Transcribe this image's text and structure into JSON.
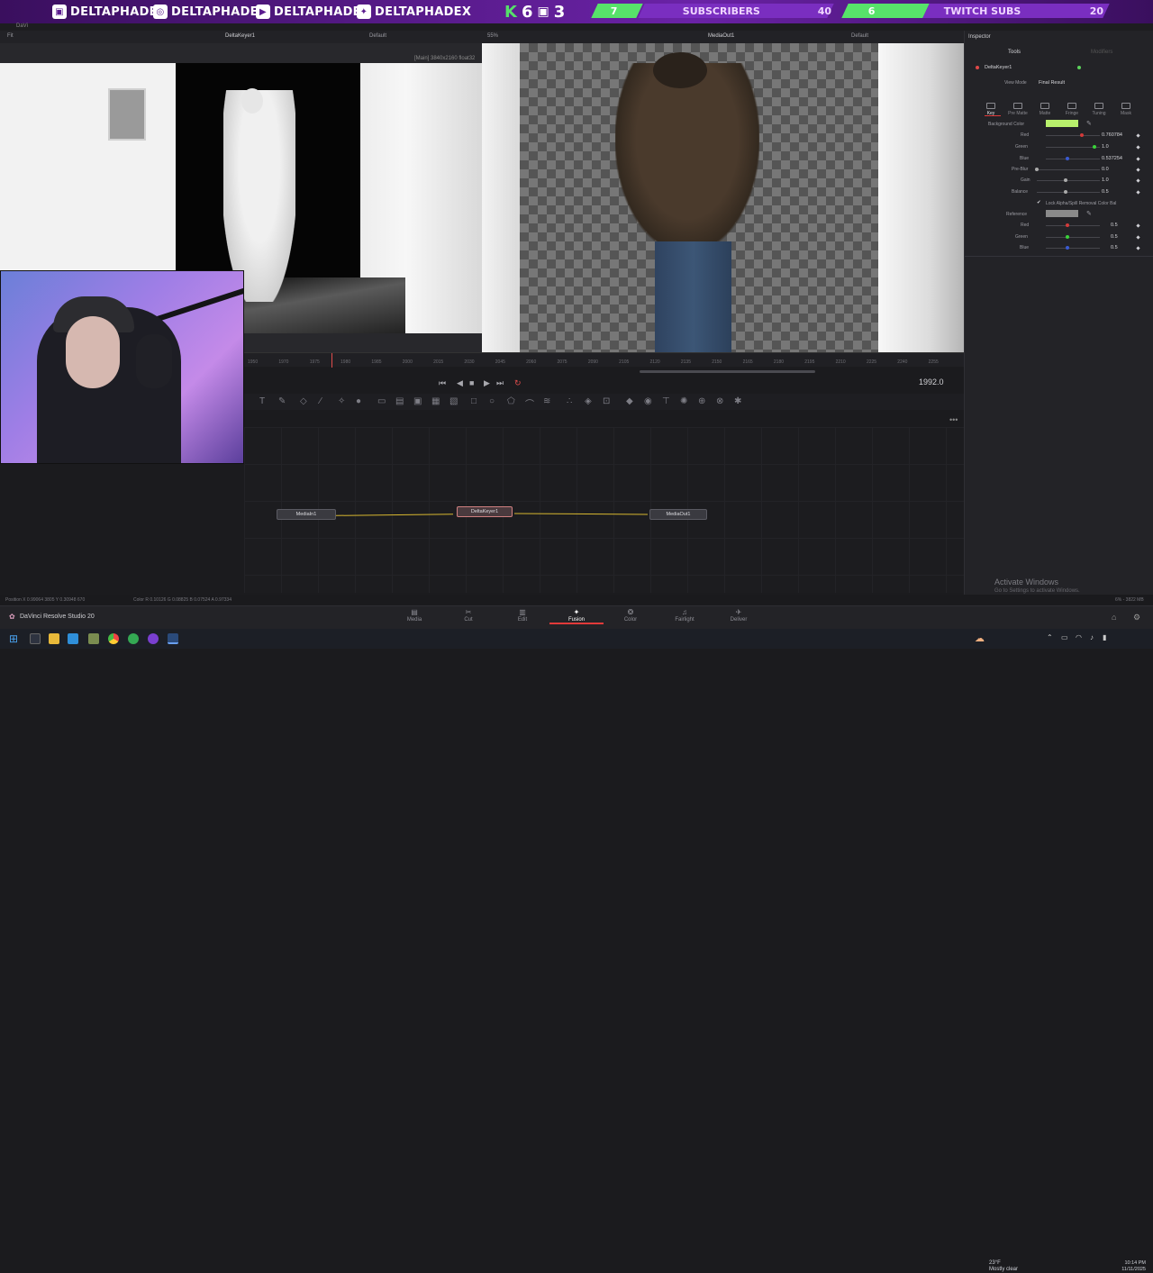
{
  "banner": {
    "socials": [
      {
        "icon": "twitch-icon",
        "handle": "DELTAPHADE"
      },
      {
        "icon": "instagram-icon",
        "handle": "DELTAPHADE"
      },
      {
        "icon": "youtube-icon",
        "handle": "DELTAPHADE"
      },
      {
        "icon": "twitter-icon",
        "handle": "DELTAPHADEX"
      }
    ],
    "kick_count": "6",
    "badge_count": "3",
    "subscribers_current": "7",
    "subscribers_label": "SUBSCRIBERS",
    "subscribers_goal": "40",
    "twitch_current": "6",
    "twitch_label": "TWITCH SUBS",
    "twitch_goal": "20"
  },
  "viewer_left": {
    "title": "DeltaKeyer1",
    "fit": "Fit",
    "lut": "Default",
    "resolution": "[Main] 3840x2160 float32"
  },
  "viewer_right": {
    "zoom": "55%",
    "title": "MediaOut1",
    "lut": "Default"
  },
  "timeline": {
    "ticks": [
      "1950",
      "1970",
      "1975",
      "1980",
      "1985",
      "2000",
      "2015",
      "2030",
      "2045",
      "2060",
      "2075",
      "2090",
      "2105",
      "2120",
      "2135",
      "2150",
      "2165",
      "2180",
      "2195",
      "2210",
      "2225",
      "2240",
      "2255"
    ],
    "frame": "1992.0"
  },
  "nodes": {
    "media_in": "MediaIn1",
    "keyer": "DeltaKeyer1",
    "media_out": "MediaOut1"
  },
  "status": {
    "position": "Position  X 0.99064    3805    Y 0.30948    670",
    "color": "Color  R 0.10126    G 0.08825    B 0.07524    A 0.97334",
    "memory": "6% - 3822 MB"
  },
  "app_name": "DaVinci Resolve Studio 20",
  "pages": [
    {
      "label": "Media",
      "icon": "media-icon"
    },
    {
      "label": "Cut",
      "icon": "cut-icon"
    },
    {
      "label": "Edit",
      "icon": "edit-icon"
    },
    {
      "label": "Fusion",
      "icon": "fusion-icon"
    },
    {
      "label": "Color",
      "icon": "color-icon"
    },
    {
      "label": "Fairlight",
      "icon": "fairlight-icon"
    },
    {
      "label": "Deliver",
      "icon": "deliver-icon"
    }
  ],
  "inspector": {
    "title": "Inspector",
    "tools_tab": "Tools",
    "modifiers_tab": "Modifiers",
    "node_name": "DeltaKeyer1",
    "view_mode_label": "View Mode",
    "view_mode_value": "Final Result",
    "tabs": [
      "Key",
      "Pre Matte",
      "Matte",
      "Fringe",
      "Tuning",
      "Mask"
    ],
    "background_color_label": "Background Color",
    "background_color_swatch": "#b8f06c",
    "params": [
      {
        "label": "Red",
        "value": "0.760784"
      },
      {
        "label": "Green",
        "value": "1.0"
      },
      {
        "label": "Blue",
        "value": "0.537254"
      },
      {
        "label": "Pre-Blur",
        "value": "0.0"
      },
      {
        "label": "Gain",
        "value": "1.0"
      },
      {
        "label": "Balance",
        "value": "0.5"
      }
    ],
    "lock_label": "Lock Alpha/Spill Removal Color Bal",
    "reference_label": "Reference",
    "ref_params": [
      {
        "label": "Red",
        "value": "0.5"
      },
      {
        "label": "Green",
        "value": "0.5"
      },
      {
        "label": "Blue",
        "value": "0.5"
      }
    ]
  },
  "watermark": {
    "line1": "Activate Windows",
    "line2": "Go to Settings to activate Windows."
  },
  "taskbar": {
    "weather_temp": "23°F",
    "weather_desc": "Mostly clear",
    "time": "10:14 PM",
    "date": "11/11/2025"
  },
  "window_title_fragment": "DaVi"
}
